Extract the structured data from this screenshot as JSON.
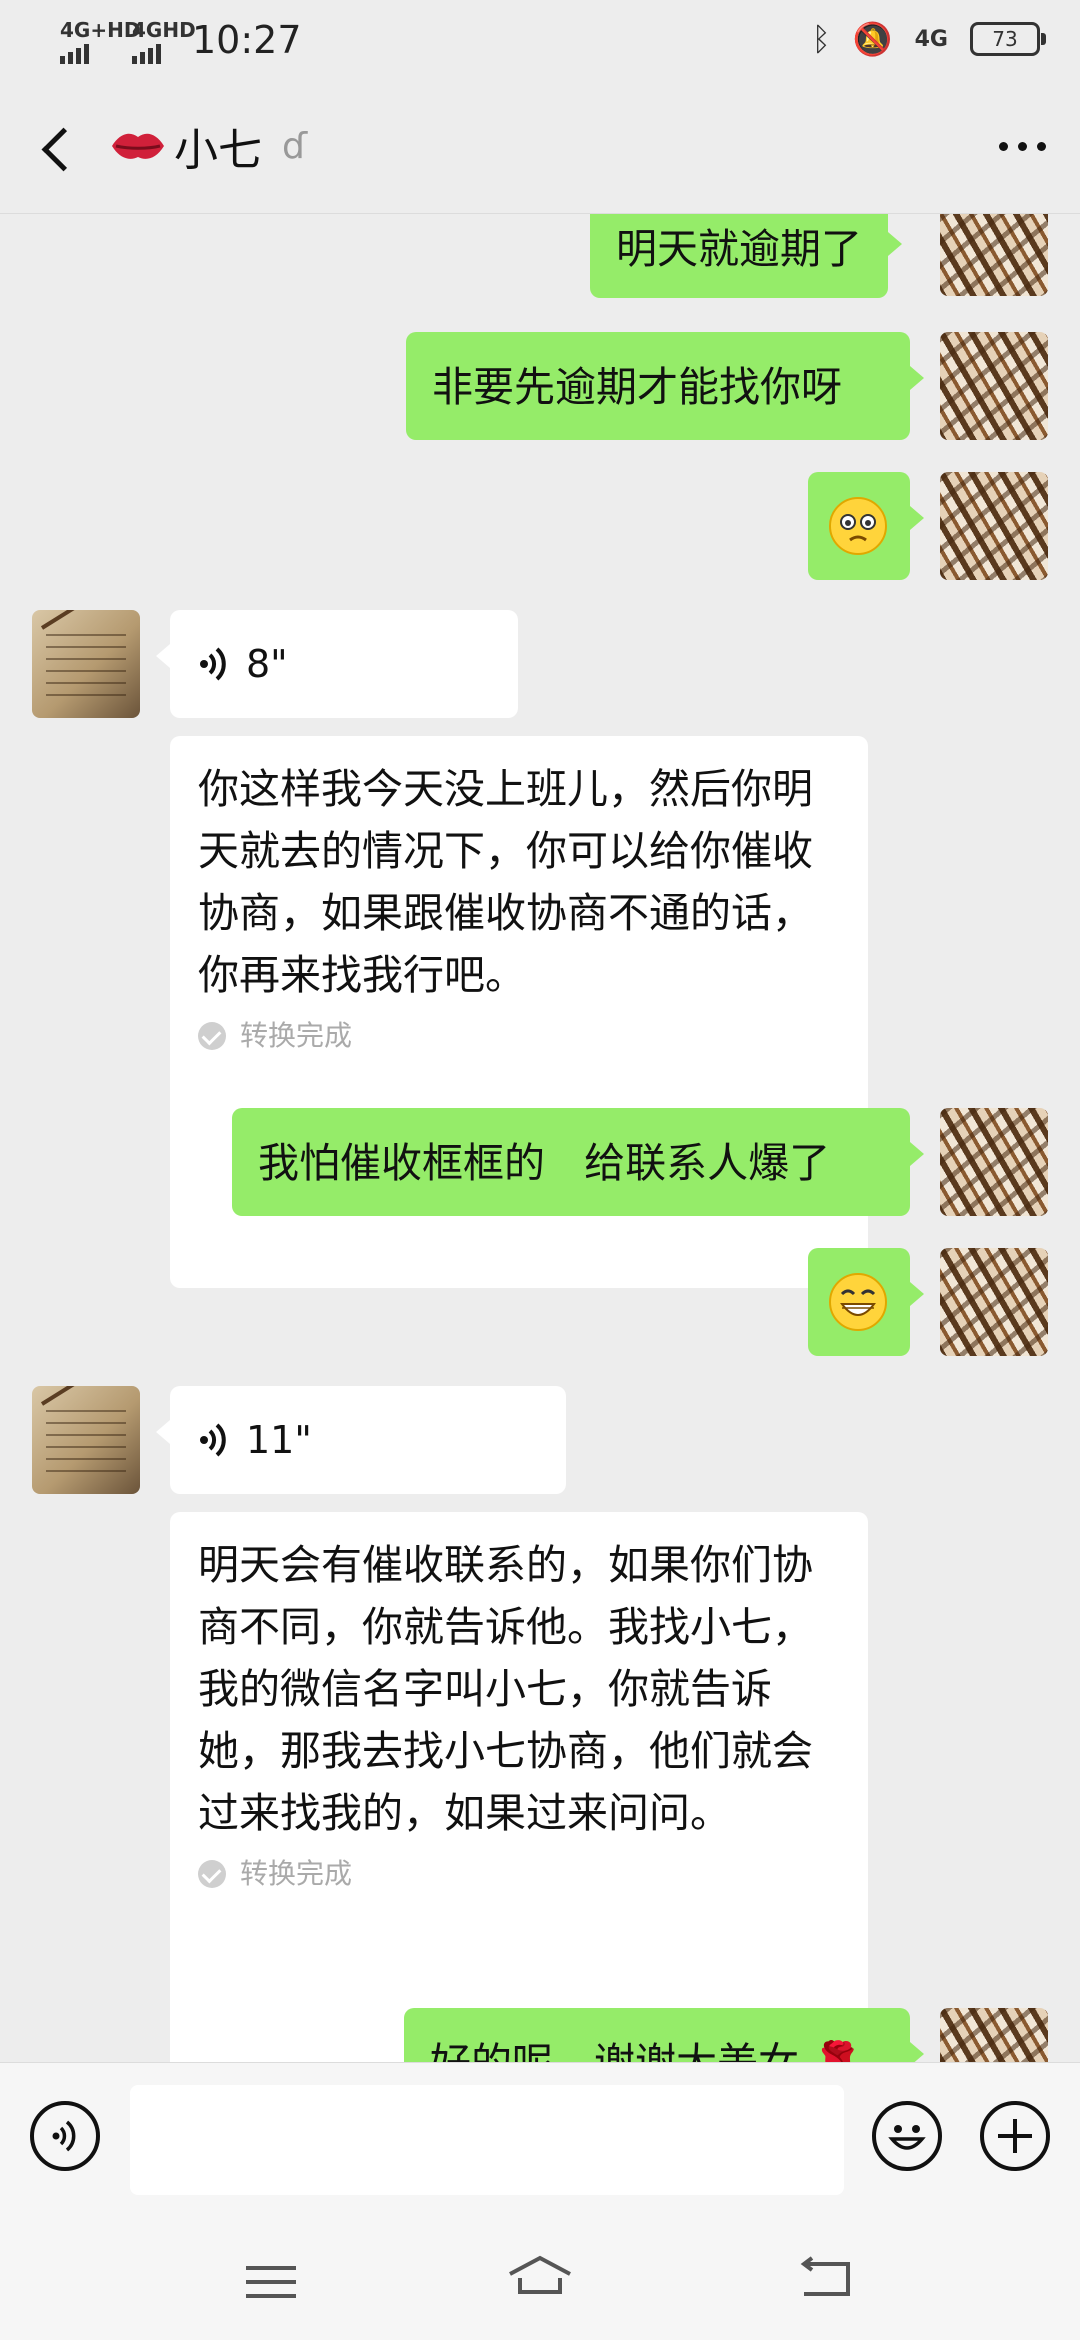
{
  "status_bar": {
    "signal1": "4G+HD",
    "signal2": "4GHD",
    "time": "10:27",
    "net": "4G",
    "battery": "73"
  },
  "header": {
    "title": "小七"
  },
  "messages": [
    {
      "id": "m1",
      "from": "me",
      "type": "text",
      "text": "明天就逾期了"
    },
    {
      "id": "m2",
      "from": "me",
      "type": "text",
      "text": "非要先逾期才能找你呀"
    },
    {
      "id": "m3",
      "from": "me",
      "type": "emoji",
      "emoji": "pleading-face"
    },
    {
      "id": "m4",
      "from": "other",
      "type": "voice",
      "duration": "8\"",
      "transcript": "你这样我今天没上班儿，然后你明天就去的情况下，你可以给你催收协商，如果跟催收协商不通的话，你再来找我行吧。",
      "status": "转换完成"
    },
    {
      "id": "m5",
      "from": "me",
      "type": "text",
      "text": "我怕催收框框的   给联系人爆了"
    },
    {
      "id": "m6",
      "from": "me",
      "type": "emoji",
      "emoji": "grinning-face"
    },
    {
      "id": "m7",
      "from": "other",
      "type": "voice",
      "duration": "11\"",
      "transcript": "明天会有催收联系的，如果你们协商不同，你就告诉他。我找小七，我的微信名字叫小七，你就告诉她，那我去找小七协商，他们就会过来找我的，如果过来问问。",
      "status": "转换完成"
    },
    {
      "id": "m8",
      "from": "me",
      "type": "text",
      "text": "好的呢，谢谢大美女"
    }
  ],
  "input": {
    "placeholder": ""
  },
  "colors": {
    "my_bubble": "#95ec69",
    "other_bubble": "#ffffff",
    "background": "#ededed"
  }
}
